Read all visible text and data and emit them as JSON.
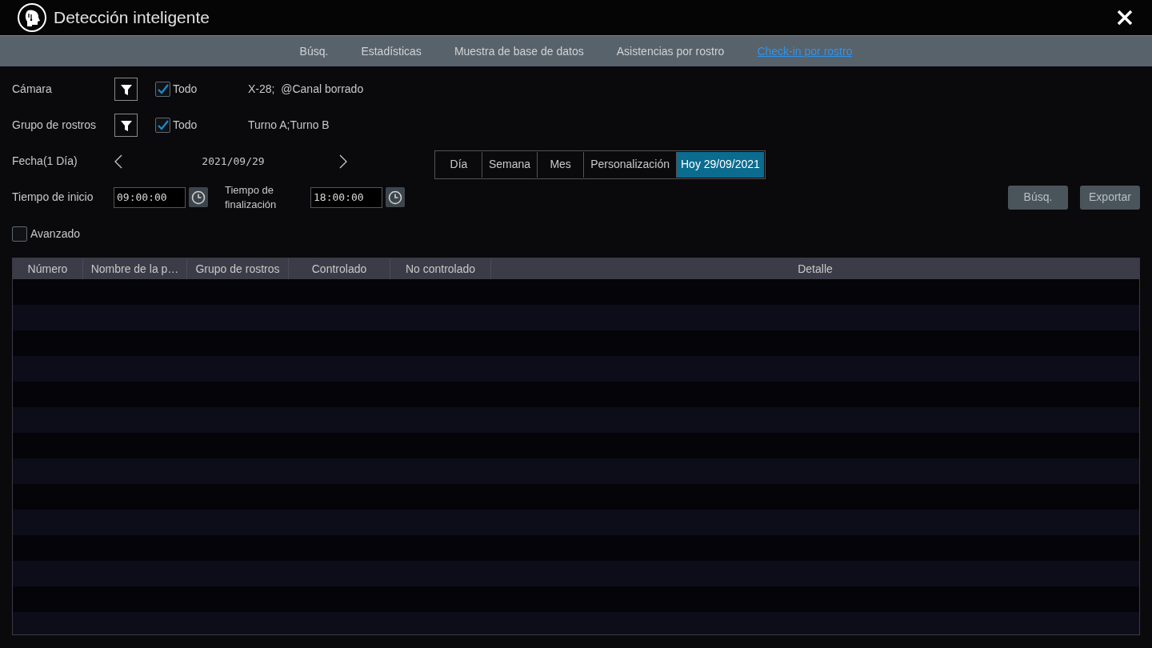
{
  "window": {
    "title": "Detección inteligente"
  },
  "tabs": [
    {
      "label": "Búsq.",
      "selected": false
    },
    {
      "label": "Estadísticas",
      "selected": false
    },
    {
      "label": "Muestra de base de datos",
      "selected": false
    },
    {
      "label": "Asistencias por rostro",
      "selected": false
    },
    {
      "label": "Check-in por rostro",
      "selected": true
    }
  ],
  "filters": [
    {
      "label": "Cámara",
      "all_label": "Todo",
      "all_checked": true,
      "value": "X-28;  @Canal borrado"
    },
    {
      "label": "Grupo de rostros",
      "all_label": "Todo",
      "all_checked": true,
      "value": "Turno A;Turno B"
    }
  ],
  "date": {
    "label": "Fecha(1 Día)",
    "value": "2021/09/29"
  },
  "ranges": [
    {
      "label": "Día",
      "selected": false
    },
    {
      "label": "Semana",
      "selected": false
    },
    {
      "label": "Mes",
      "selected": false
    },
    {
      "label": "Personalización",
      "selected": false
    },
    {
      "label": "Hoy 29/09/2021",
      "selected": true
    }
  ],
  "start_time": {
    "label": "Tiempo de inicio",
    "value": "09:00:00"
  },
  "end_time": {
    "label": "Tiempo de finalización",
    "value": "18:00:00"
  },
  "buttons": [
    "Búsq.",
    "Exportar"
  ],
  "advanced": {
    "label": "Avanzado",
    "checked": false
  },
  "table": {
    "columns": [
      "Número",
      "Nombre de la p…",
      "Grupo de rostros",
      "Controlado",
      "No controlado",
      "Detalle"
    ]
  }
}
